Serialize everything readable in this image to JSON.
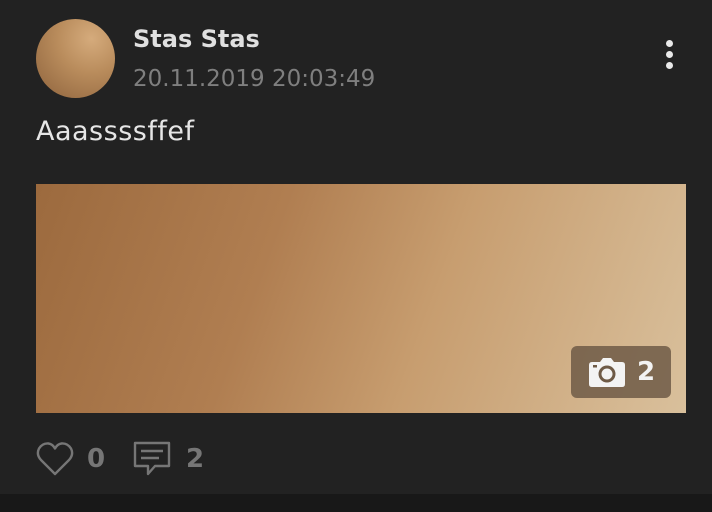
{
  "post": {
    "author_name": "Stas Stas",
    "date": "20.11.2019 20:03:49",
    "text": "Aaassssffef",
    "photo_count": "2",
    "likes": "0",
    "comments": "2"
  },
  "icons": {
    "menu": "more-vertical-icon",
    "photos": "camera-icon",
    "like": "heart-icon",
    "comment": "comment-icon"
  },
  "colors": {
    "card_background": "#222222",
    "text_primary": "#e0e0e0",
    "text_muted": "#7f7f7f",
    "image_gradient_start": "#9c6a3e",
    "image_gradient_end": "#d9c09c"
  }
}
